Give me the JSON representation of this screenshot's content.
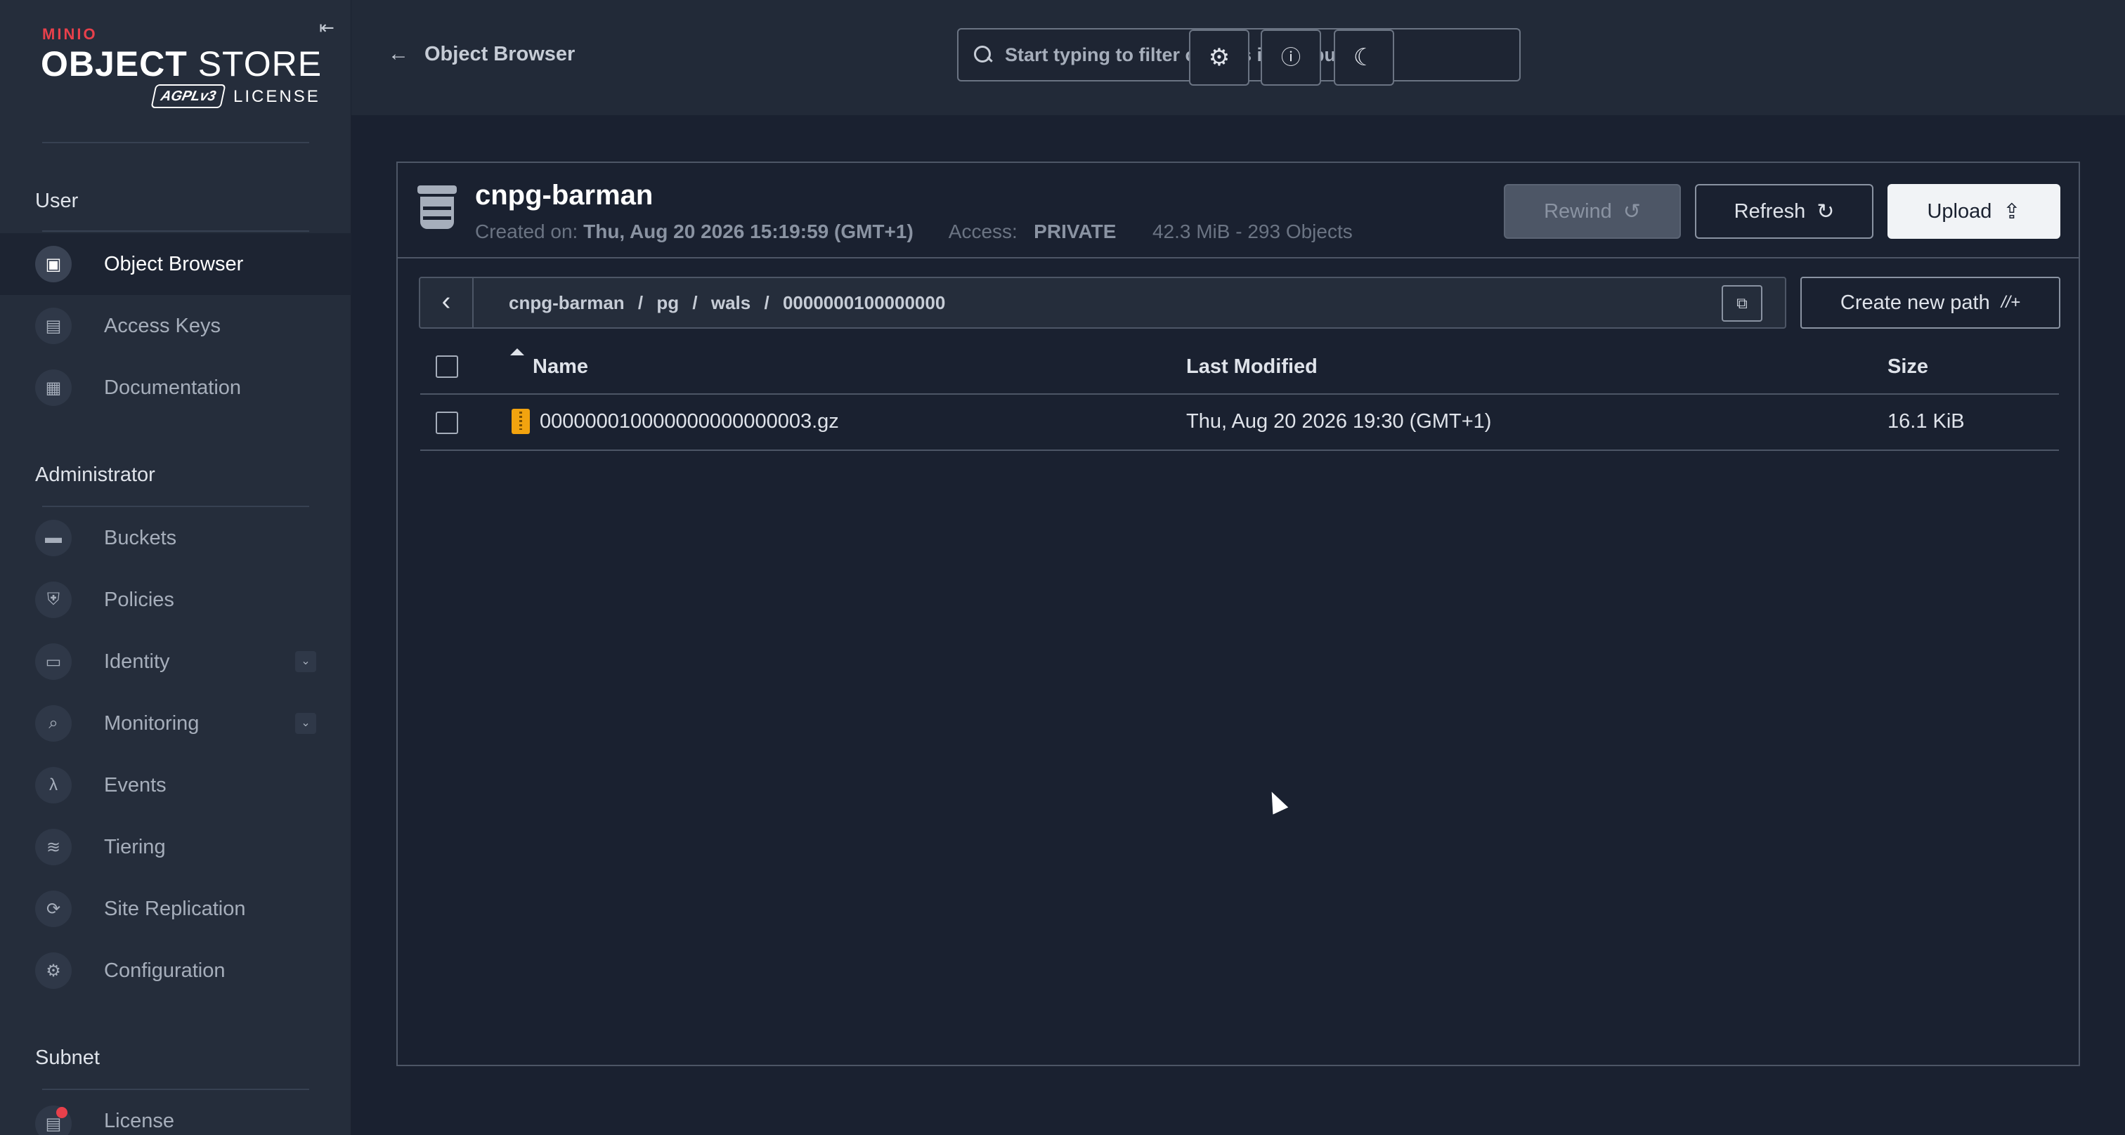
{
  "logo": {
    "brand": "MINIO",
    "product_bold": "OBJECT",
    "product_light": " STORE",
    "license_badge": "AGPLv3",
    "license_label": "LICENSE"
  },
  "sidebar": {
    "sections": {
      "user": "User",
      "administrator": "Administrator",
      "subnet": "Subnet"
    },
    "user_items": [
      {
        "label": "Object Browser",
        "icon": "object-browser-icon",
        "active": true
      },
      {
        "label": "Access Keys",
        "icon": "key-icon"
      },
      {
        "label": "Documentation",
        "icon": "docs-icon"
      }
    ],
    "admin_items": [
      {
        "label": "Buckets",
        "icon": "bucket-icon"
      },
      {
        "label": "Policies",
        "icon": "shield-icon"
      },
      {
        "label": "Identity",
        "icon": "id-card-icon",
        "expandable": true
      },
      {
        "label": "Monitoring",
        "icon": "magnifier-icon",
        "expandable": true
      },
      {
        "label": "Events",
        "icon": "lambda-icon"
      },
      {
        "label": "Tiering",
        "icon": "layers-icon"
      },
      {
        "label": "Site Replication",
        "icon": "sync-icon"
      },
      {
        "label": "Configuration",
        "icon": "gear-icon"
      }
    ],
    "subnet_items": [
      {
        "label": "License",
        "icon": "license-icon",
        "badge": true
      }
    ]
  },
  "header": {
    "back_label": "Object Browser",
    "search_placeholder": "Start typing to filter objects in the bucket"
  },
  "bucket": {
    "name": "cnpg-barman",
    "created_label": "Created on:",
    "created_value": "Thu, Aug 20 2026 15:19:59 (GMT+1)",
    "access_label": "Access:",
    "access_value": "PRIVATE",
    "usage": "42.3 MiB - 293 Objects",
    "rewind_label": "Rewind",
    "refresh_label": "Refresh",
    "upload_label": "Upload"
  },
  "path": {
    "crumbs": [
      "cnpg-barman",
      "pg",
      "wals",
      "0000000100000000"
    ],
    "separator": "/",
    "create_label": "Create new path"
  },
  "table": {
    "columns": [
      "Name",
      "Last Modified",
      "Size"
    ],
    "rows": [
      {
        "name": "000000010000000000000003.gz",
        "modified": "Thu, Aug 20 2026 19:30 (GMT+1)",
        "size": "16.1 KiB"
      }
    ]
  },
  "colors": {
    "accent_red": "#e8404b",
    "file_icon": "#f2a30f",
    "background": "#1a2130",
    "sidebar": "#252d3b"
  }
}
